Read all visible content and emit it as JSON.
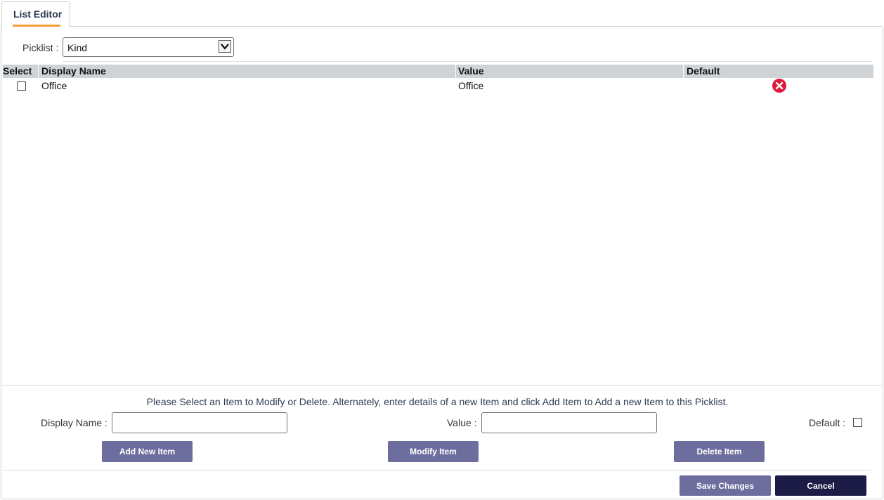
{
  "tab": {
    "label": "List Editor"
  },
  "picklist": {
    "label": "Picklist :",
    "selected": "Kind"
  },
  "grid": {
    "columns": [
      "Select",
      "Display Name",
      "Value",
      "Default"
    ],
    "rows": [
      {
        "display_name": "Office",
        "value": "Office",
        "checked": false
      }
    ]
  },
  "form": {
    "instructions": "Please Select an Item to Modify or Delete. Alternately, enter details of a new Item and click Add Item to Add a new Item to this Picklist.",
    "display_name_label": "Display Name :",
    "display_name_value": "",
    "value_label": "Value :",
    "value_value": "",
    "default_label": "Default :"
  },
  "buttons": {
    "add": "Add New Item",
    "modify": "Modify Item",
    "delete": "Delete Item",
    "save": "Save Changes",
    "cancel": "Cancel"
  },
  "colors": {
    "tab_accent": "#f0a030",
    "header_bg": "#cfd3d6",
    "secondary_button": "#6e6e9e",
    "primary_button": "#1c1c46",
    "delete_icon": "#e0193c"
  },
  "icons": [
    "chevron-down-icon",
    "delete-circle-icon"
  ]
}
